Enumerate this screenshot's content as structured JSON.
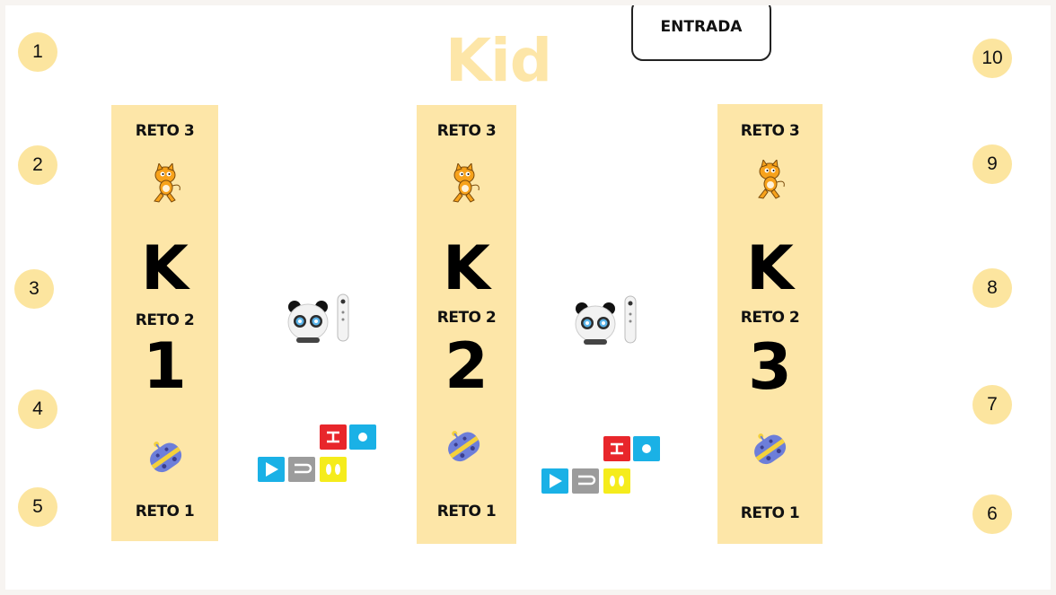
{
  "title": "Kid",
  "entrada": "ENTRADA",
  "numbers_left": [
    "1",
    "2",
    "3",
    "4",
    "5"
  ],
  "numbers_right": [
    "10",
    "9",
    "8",
    "7",
    "6"
  ],
  "columns": [
    {
      "reto_top": "RETO 3",
      "letter": "K",
      "reto_mid": "RETO 2",
      "digit": "1",
      "reto_bottom": "RETO 1"
    },
    {
      "reto_top": "RETO 3",
      "letter": "K",
      "reto_mid": "RETO 2",
      "digit": "2",
      "reto_bottom": "RETO 1"
    },
    {
      "reto_top": "RETO 3",
      "letter": "K",
      "reto_mid": "RETO 2",
      "digit": "3",
      "reto_bottom": "RETO 1"
    }
  ],
  "icons": {
    "cat": "scratch-cat-icon",
    "robot": "robot-icon",
    "panda": "panda-robot-icon",
    "remote": "remote-control-icon",
    "blocks": "code-blocks-icon"
  },
  "colors": {
    "accent": "#fde6a8",
    "circle": "#fce59f",
    "block_blue": "#1ab1e6",
    "block_red": "#e8262b",
    "block_gray": "#9c9c9c",
    "block_yellow": "#f5ec1c"
  }
}
